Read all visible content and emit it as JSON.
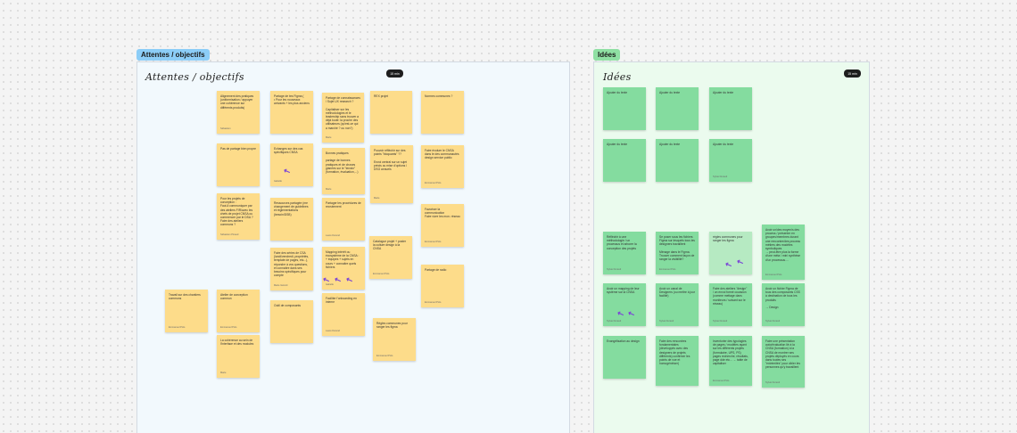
{
  "sections": [
    {
      "tag": "Attentes / objectifs",
      "title": "Attentes / objectifs",
      "badge": "15 min",
      "tag_color": "#8ccdf7",
      "bg": "#f2f9fd"
    },
    {
      "tag": "Idées",
      "title": "Idées",
      "badge": "15 min",
      "tag_color": "#8fe0a3",
      "bg": "#ebfbee"
    }
  ],
  "attentes_notes": [
    {
      "text": "Alignement des pratiques (uniformisation / appuyer une cohérence sur différents produits)",
      "author": "Sébastien"
    },
    {
      "text": "Partage de tes Figma (\n• Pour les nouveaux arrivants + les plus anciens",
      "author": ""
    },
    {
      "text": "Partage de connaissances / Sujet UX research ?\n\nCapitaliser sur les méthodologies et le leadership sans trouver a déjà toute: la proche des utilisateurs (qu'est-ce qui a marché ? ou non?)",
      "author": "Marie"
    },
    {
      "text": "REX projet",
      "author": ""
    },
    {
      "text": "Normes communes ?",
      "author": ""
    },
    {
      "text": "Pas de partage bien propre",
      "author": ""
    },
    {
      "text": "Echanges sur des cas spécifiques CNSA",
      "author": "Isabelle"
    },
    {
      "text": "Bonnes pratiques\n\npartage de bonnes pratiques et de choses glanées sur le \"terrain\" (formation, évaluation,...)",
      "author": "Marie"
    },
    {
      "text": "Pouvoir réfléchir sur des points \"bloquants\" ??\n\nEnvoi central sur un sujet précis ou mise d'options / DSG annuels",
      "author": "Marie"
    },
    {
      "text": "Faire évoluer le CNSA dans le des communautés design service public",
      "author": "Emmanuel Polo"
    },
    {
      "text": "Pour les projets de conception :\nFaut-il communiquer par des ateliers FIR/avec les chefs de projet CNSA ou commencer par le DSA ? Faire des ateliers communs ?",
      "author": "Sébastien Pinaud"
    },
    {
      "text": "Ressources partagée (me changement de guidelines et règlementations (besoin/DSB)",
      "author": ""
    },
    {
      "text": "Partager les procédures de recrutement",
      "author": "Laure Durand"
    },
    {
      "text": "Favoriser la communication \nFaire vivre les mon. réseau",
      "author": "Emmanuel Polo"
    },
    {
      "text": "Faire des séries de CSA (lundi/vendredi, propriétés, template de pages, etc...), répondre à vos questions, et connaître dans ses besoins spécifiques pour compte",
      "author": "Marie Gérard"
    },
    {
      "text": "Mapping intérêt ou écosystème de la CNSA : + équipes + sujets en cours + connaitre quels fichiers",
      "author": "Isabelle"
    },
    {
      "text": "Catalogue projet + poster la culture design à la CNSA",
      "author": "Emmanuel Polo"
    },
    {
      "text": "Partage de radio",
      "author": "Emmanuel Polo"
    },
    {
      "text": "Travail sur des chantiers communs",
      "author": "Emmanuel Polo"
    },
    {
      "text": "Atelier de conception commun",
      "author": "Emmanuel Polo"
    },
    {
      "text": "Outil de composants",
      "author": ""
    },
    {
      "text": "Faciliter l'onboarding en interne",
      "author": "Laure Durand"
    },
    {
      "text": "Règles communes pour ranger les figma",
      "author": "Emmanuel Polo"
    },
    {
      "text": "La cohérence au sein de l'interface et des modules",
      "author": "Marie"
    }
  ],
  "idees_notes": [
    {
      "text": "Ajouter du texte",
      "author": ""
    },
    {
      "text": "Ajouter du texte",
      "author": ""
    },
    {
      "text": "Ajouter du texte",
      "author": ""
    },
    {
      "text": "Ajouter du texte",
      "author": ""
    },
    {
      "text": "Ajouter du texte",
      "author": ""
    },
    {
      "text": "Ajouter du texte",
      "author": "Sylvie Durand"
    },
    {
      "text": "Réfléchir à une méthodologie / un processus et arborer la conception des projets",
      "author": "Sylvie Durand"
    },
    {
      "text": "Se poser sous les fichiers Figma sur lesquels tous les designers travaillent\n\nMénage dans le Figma. Trouver comment façon de ranger la visibilité?",
      "author": "Emmanuel Polo"
    },
    {
      "text": "règles communes pour ranger les figma",
      "author": ""
    },
    {
      "text": "Avoir un/des moyen/s des process / présenter en groupes/membres durant une rencontre/des process métiers des modèles symboliques\n→ peut-être plus la forme d'une méta / mini synthèse d'un processus....",
      "author": "Emmanuel Polo"
    },
    {
      "text": "Avoir un mapping de leur système sur la CNSA",
      "author": "Sylvie Durand"
    },
    {
      "text": "Avoir un canal de Designers (ou mettre à jour facilité)",
      "author": "Sylvie Durand"
    },
    {
      "text": "Faire des ateliers \"design\" / un envoi formé occasion (comme mettage dans moniteurs / suivant sur le réseau)",
      "author": "Sylvie Durand"
    },
    {
      "text": "Avoir un fichier Figma de tous des composants CSS à destination de tous les produits\n\n→ Design",
      "author": "Sylvie Durand"
    },
    {
      "text": "Evangélisation au design",
      "author": ""
    },
    {
      "text": "Faire des rencontres fondamentales (développés avec des designers de projets différents) confirmer les points de vue et homogénéiser)",
      "author": ""
    },
    {
      "text": "Inventorier des typologies de pages / modèles ayant sur les différents projets (formulaire, UPS, PS) pages recherche, résultats, page dde etc... → table de capitaliser",
      "author": "Emmanuel Polo"
    },
    {
      "text": "Faire une présentation auto/évaluation lié à la CNSA (formation) à la CNSA de montrer ses projets déployés en cours dans toutes ses \"extrémités\" pour cibler les personnes qu'y travaillent",
      "author": "Sylvie Durand"
    }
  ],
  "cursor_symbol": "↖"
}
